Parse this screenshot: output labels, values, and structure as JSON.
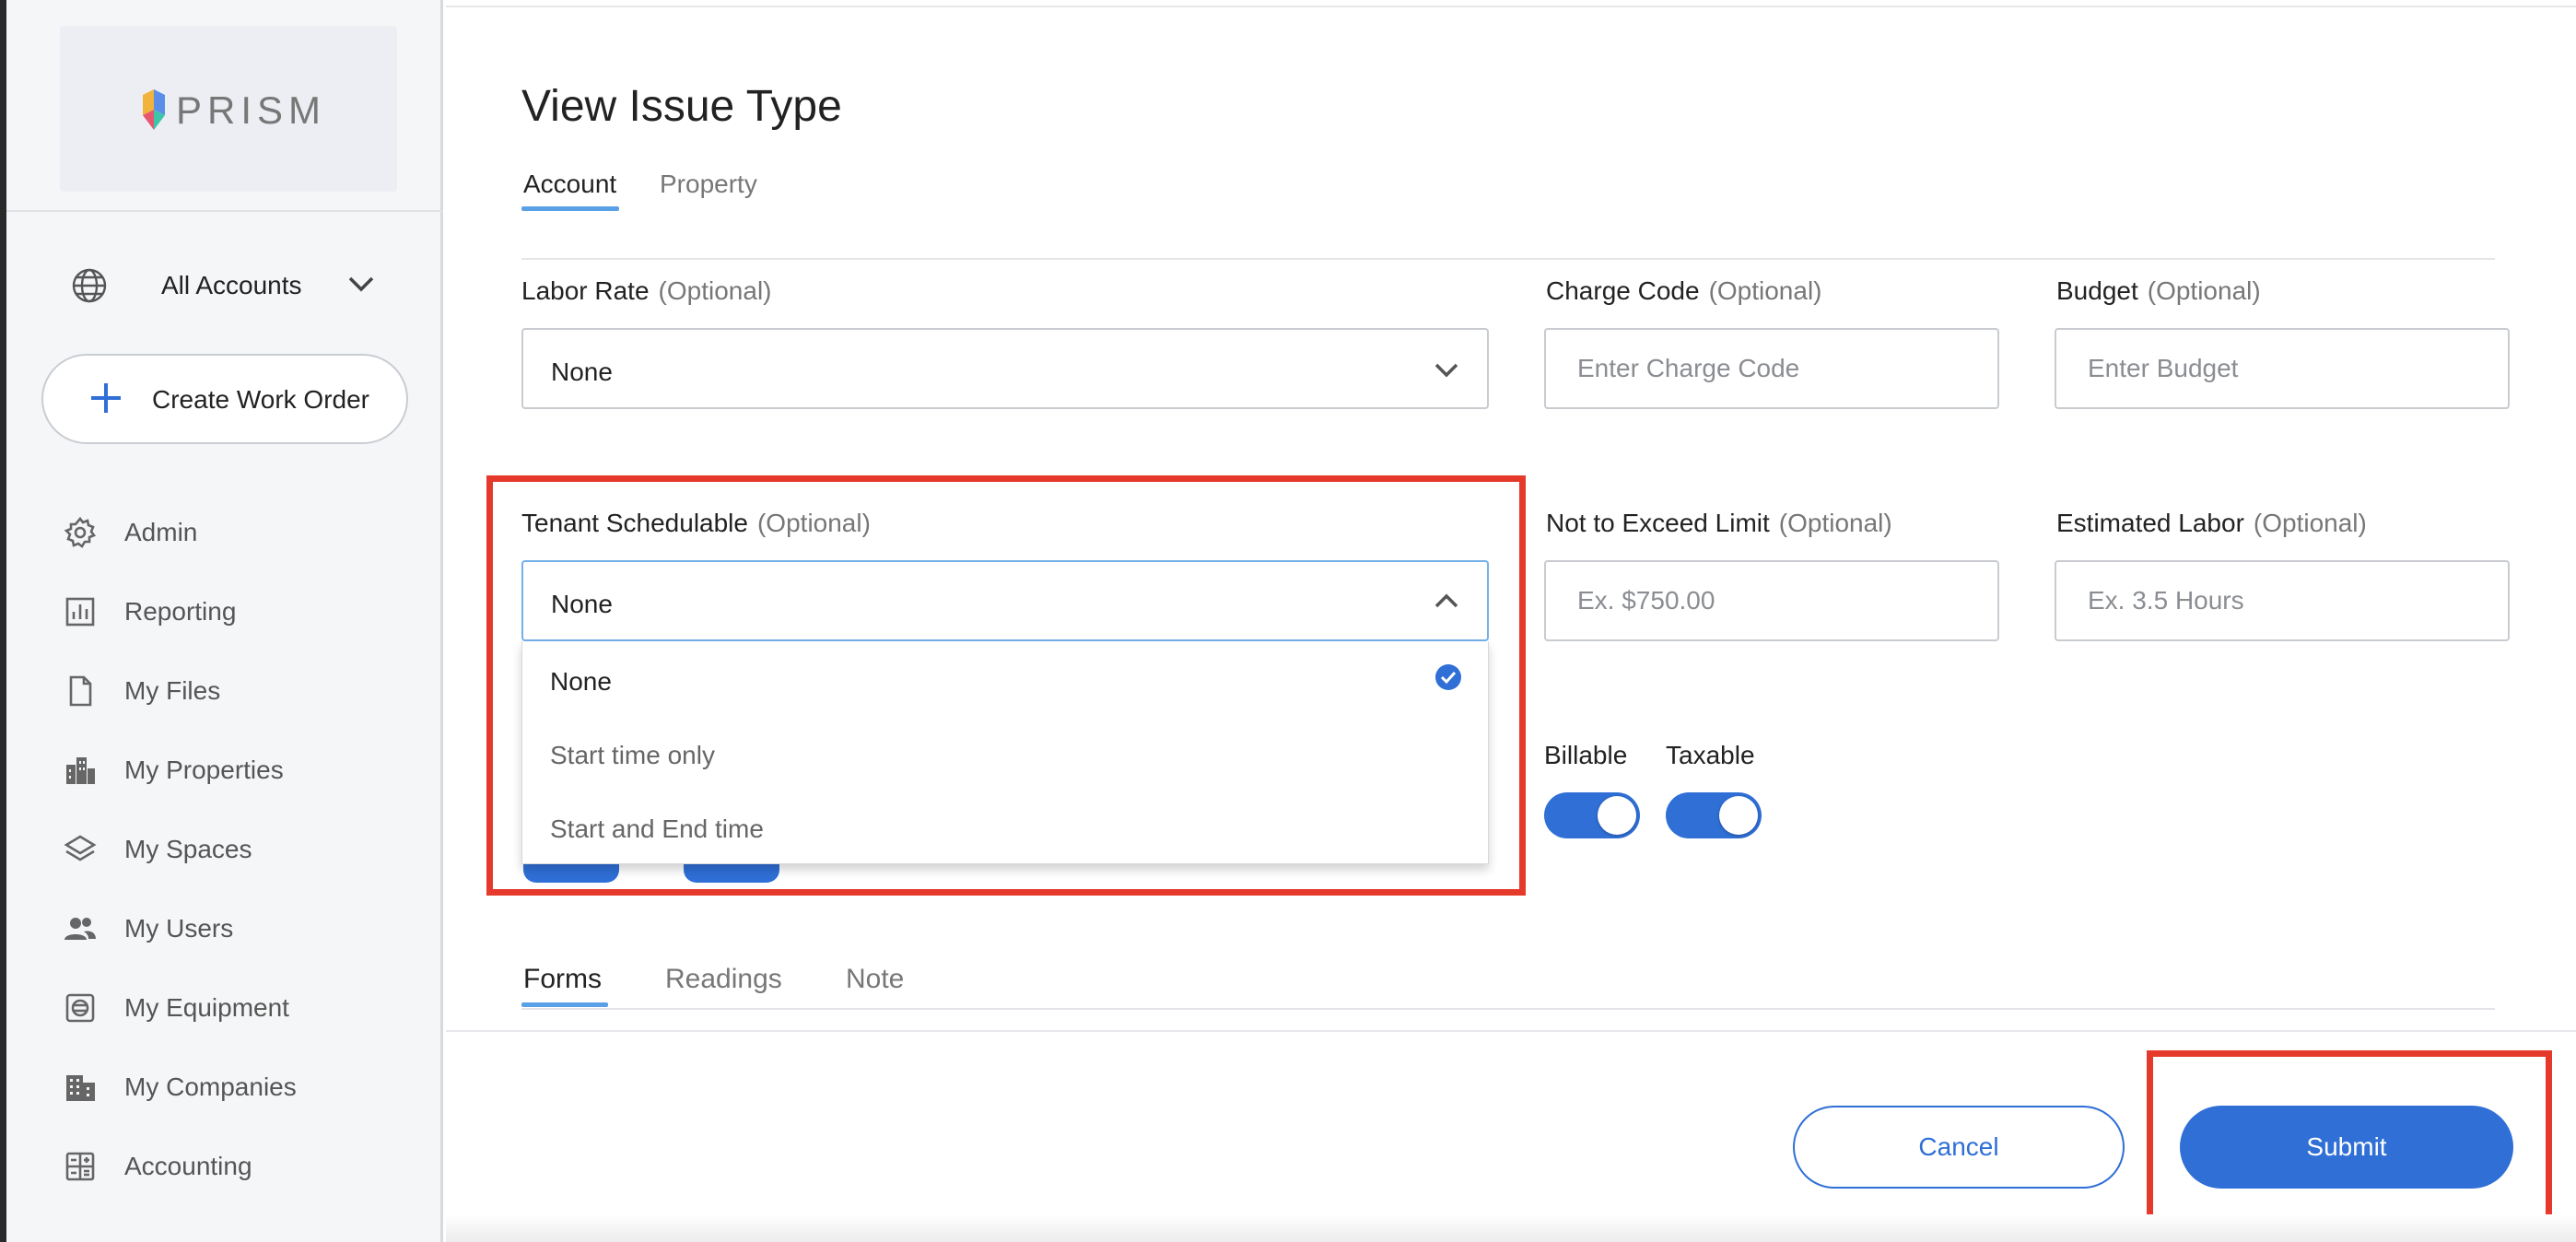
{
  "sidebar": {
    "logo_text": "PRISM",
    "account_selector": {
      "label": "All Accounts",
      "icon": "globe-icon"
    },
    "create_button": {
      "label": "Create Work Order",
      "icon": "plus-icon"
    },
    "nav_items": [
      {
        "label": "Admin",
        "icon": "gear-icon"
      },
      {
        "label": "Reporting",
        "icon": "bar-chart-icon"
      },
      {
        "label": "My Files",
        "icon": "file-icon"
      },
      {
        "label": "My Properties",
        "icon": "buildings-icon"
      },
      {
        "label": "My Spaces",
        "icon": "layers-icon"
      },
      {
        "label": "My Users",
        "icon": "users-icon"
      },
      {
        "label": "My Equipment",
        "icon": "equipment-icon"
      },
      {
        "label": "My Companies",
        "icon": "company-icon"
      },
      {
        "label": "Accounting",
        "icon": "calculator-icon"
      }
    ]
  },
  "main": {
    "title": "View Issue Type",
    "top_tabs": [
      {
        "label": "Account",
        "active": true
      },
      {
        "label": "Property",
        "active": false
      }
    ],
    "optional_tag": "(Optional)",
    "fields": {
      "labor_rate": {
        "label": "Labor Rate",
        "value": "None"
      },
      "charge_code": {
        "label": "Charge Code",
        "placeholder": "Enter Charge Code"
      },
      "budget": {
        "label": "Budget",
        "placeholder": "Enter Budget"
      },
      "tenant_schedulable": {
        "label": "Tenant Schedulable",
        "value": "None",
        "options": [
          "None",
          "Start time only",
          "Start and End time"
        ],
        "selected_index": 0
      },
      "not_to_exceed": {
        "label": "Not to Exceed Limit",
        "placeholder": "Ex. $750.00"
      },
      "estimated_labor": {
        "label": "Estimated Labor",
        "placeholder": "Ex. 3.5 Hours"
      }
    },
    "toggles": {
      "billable": {
        "label": "Billable",
        "on": true
      },
      "taxable": {
        "label": "Taxable",
        "on": true
      }
    },
    "bottom_tabs": [
      {
        "label": "Forms",
        "active": true
      },
      {
        "label": "Readings",
        "active": false
      },
      {
        "label": "Note",
        "active": false
      }
    ],
    "actions": {
      "cancel_label": "Cancel",
      "submit_label": "Submit"
    }
  },
  "colors": {
    "accent": "#2f6fd6",
    "highlight": "#e5392b",
    "tab_underline": "#5aa0e6"
  }
}
